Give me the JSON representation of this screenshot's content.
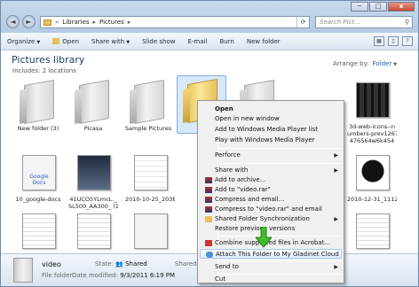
{
  "window": {
    "min": "─",
    "max": "□",
    "close": "x"
  },
  "nav": {
    "back": "◄",
    "forward": "►"
  },
  "address": {
    "parts": [
      "Libraries",
      "Pictures"
    ],
    "refresh": "⟳"
  },
  "search": {
    "placeholder": "Search Pict..."
  },
  "toolbar": {
    "organize": "Organize",
    "open": "Open",
    "share_with": "Share with",
    "slide_show": "Slide show",
    "email": "E-mail",
    "burn": "Burn",
    "new_folder": "New folder"
  },
  "library": {
    "title": "Pictures library",
    "subtitle": "Includes: 2 locations",
    "arrange_label": "Arrange by:",
    "arrange_value": "Folder"
  },
  "items": [
    {
      "label": "New folder (3)"
    },
    {
      "label": "Picasa"
    },
    {
      "label": "Sample Pictures"
    },
    {
      "label": "3d-web-icons--n"
    },
    {
      "label": "umbers-prev1267"
    },
    {
      "label": "476564w6k454"
    },
    {
      "label": "10_google-docs"
    },
    {
      "label": "41UCO5YLmcL._"
    },
    {
      "label": "SL500_AA300_ (1)"
    },
    {
      "label": "2010-10-25_2038"
    },
    {
      "label": "2010-12-31_1112"
    },
    {
      "label": "2010-12-31_1112"
    },
    {
      "label": "Google Docs"
    }
  ],
  "context_menu": {
    "items": [
      {
        "label": "Open",
        "bold": true
      },
      {
        "label": "Open in new window"
      },
      {
        "label": "Add to Windows Media Player list"
      },
      {
        "label": "Play with Windows Media Player"
      },
      {
        "label": "Perforce",
        "submenu": true
      },
      {
        "label": "Share with",
        "submenu": true
      },
      {
        "label": "Add to archive..."
      },
      {
        "label": "Add to \"video.rar\""
      },
      {
        "label": "Compress and email..."
      },
      {
        "label": "Compress to \"video.rar\" and email"
      },
      {
        "label": "Shared Folder Synchronization",
        "submenu": true
      },
      {
        "label": "Restore previous versions"
      },
      {
        "label": "Combine supported files in Acrobat..."
      },
      {
        "label": "Attach This Folder to My Gladinet Cloud"
      },
      {
        "label": "Send to",
        "submenu": true
      },
      {
        "label": "Cut"
      }
    ]
  },
  "status": {
    "name": "video",
    "type": "File folder",
    "state_label": "State:",
    "state_value": "Shared",
    "modified_label": "Date modified:",
    "modified_value": "9/3/2011 6:19 PM",
    "shared_label": "Shared"
  },
  "colors": {
    "accent": "#1e5aa8",
    "folder_yellow": "#f3d77a",
    "highlight": "#e2eefc"
  }
}
